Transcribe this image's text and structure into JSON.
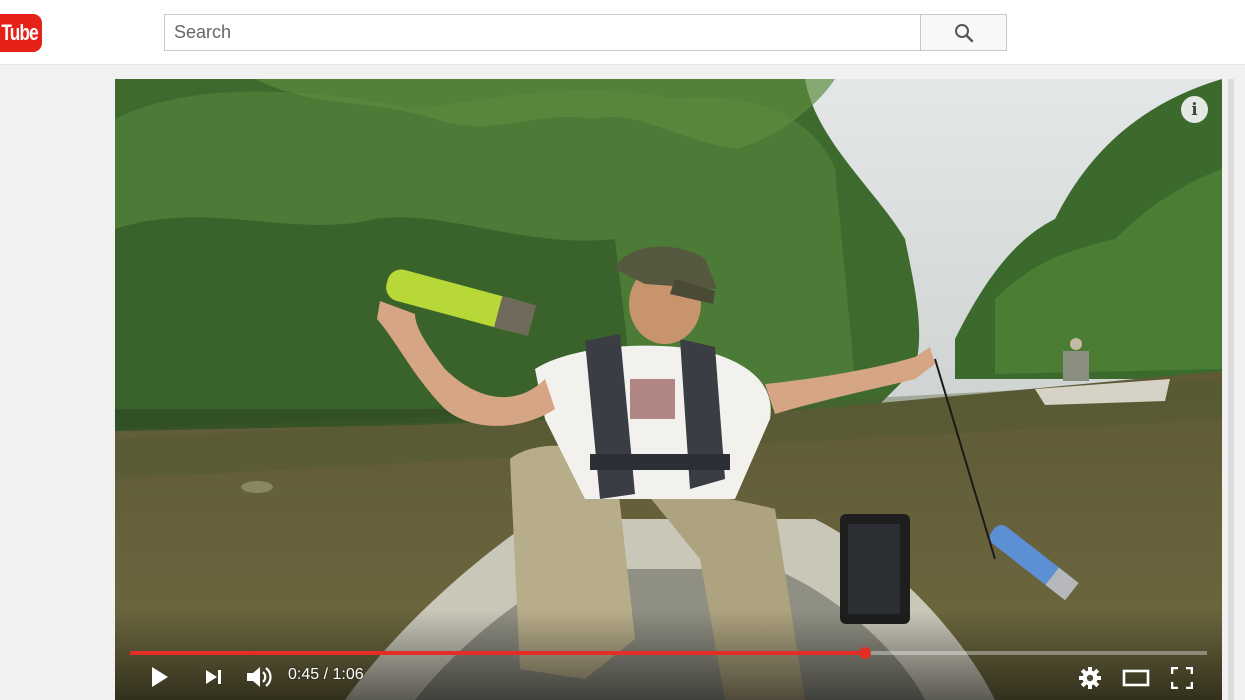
{
  "header": {
    "logo_text": "Tube",
    "search": {
      "placeholder": "Search",
      "value": ""
    },
    "search_button_icon": "search-icon"
  },
  "player": {
    "info_icon_label": "i",
    "current_time": "0:45",
    "duration": "1:06",
    "time_display": "0:45 / 1:06",
    "progress_fraction": 0.682,
    "controls": {
      "play_icon": "play-icon",
      "next_icon": "next-icon",
      "volume_icon": "volume-icon",
      "settings_icon": "gear-icon",
      "theater_icon": "theater-mode-icon",
      "fullscreen_icon": "fullscreen-icon"
    }
  },
  "colors": {
    "brand_red": "#e62117",
    "progress_red": "#e52d27"
  }
}
